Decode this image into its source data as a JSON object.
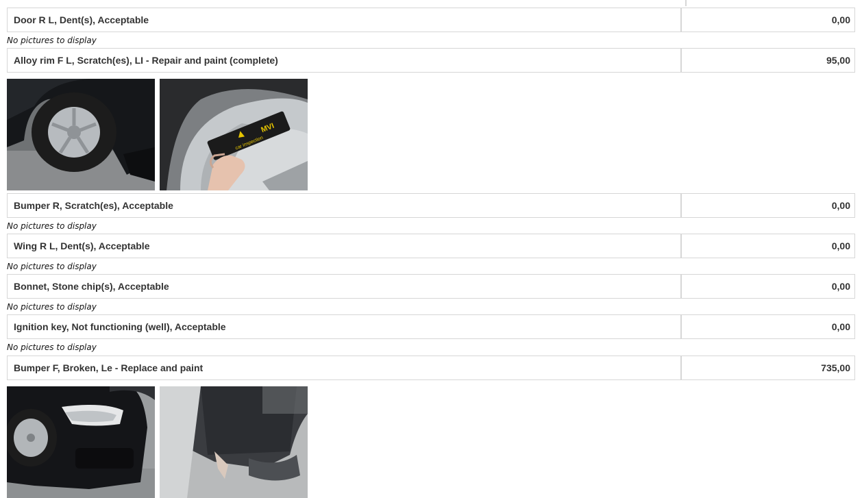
{
  "items": [
    {
      "description": "Door R L, Dent(s), Acceptable",
      "amount": "0,00",
      "note": "No pictures to display"
    },
    {
      "description": "Alloy rim F L, Scratch(es), LI - Repair and paint (complete)",
      "amount": "95,00",
      "photos": [
        "damage-photo-wheel-side",
        "damage-photo-rim-gauge"
      ]
    },
    {
      "description": "Bumper R, Scratch(es), Acceptable",
      "amount": "0,00",
      "note": "No pictures to display"
    },
    {
      "description": "Wing R L, Dent(s), Acceptable",
      "amount": "0,00",
      "note": "No pictures to display"
    },
    {
      "description": "Bonnet, Stone chip(s), Acceptable",
      "amount": "0,00",
      "note": "No pictures to display"
    },
    {
      "description": "Ignition key, Not functioning (well), Acceptable",
      "amount": "0,00",
      "note": "No pictures to display"
    },
    {
      "description": "Bumper F, Broken, Le - Replace and paint",
      "amount": "735,00",
      "photos": [
        "damage-photo-front-car",
        "damage-photo-bumper-closeup"
      ]
    }
  ],
  "gauge_card": {
    "logo": "MVI",
    "caption": "car inspection"
  }
}
